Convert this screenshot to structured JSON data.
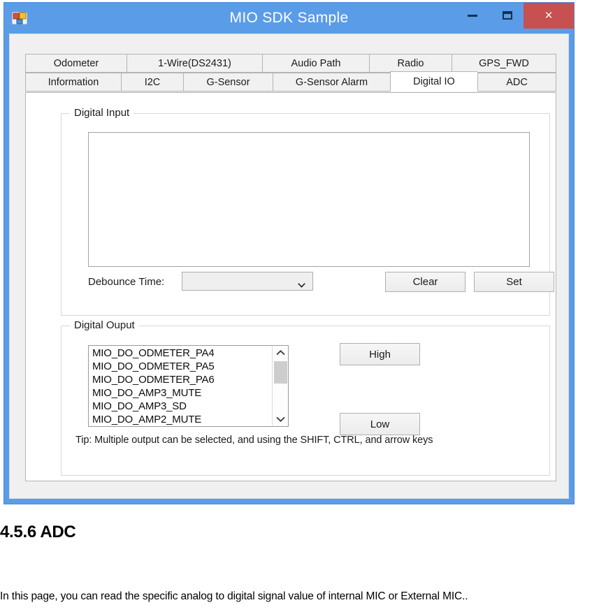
{
  "window": {
    "title": "MIO SDK Sample",
    "icon": "application-form-icon",
    "controls": {
      "minimize": "minimize-icon",
      "maximize": "maximize-icon",
      "close": "×"
    },
    "accent_color": "#5b9ce8",
    "close_color": "#c75050"
  },
  "tabs": {
    "row_top": [
      {
        "label": "Odometer",
        "width": 145,
        "selected": false
      },
      {
        "label": "1-Wire(DS2431)",
        "width": 194,
        "selected": false
      },
      {
        "label": "Audio Path",
        "width": 153,
        "selected": false
      },
      {
        "label": "Radio",
        "width": 118,
        "selected": false
      },
      {
        "label": "GPS_FWD",
        "width": 150,
        "selected": false
      }
    ],
    "row_bottom": [
      {
        "label": "Information",
        "width": 137,
        "selected": false
      },
      {
        "label": "I2C",
        "width": 89,
        "selected": false
      },
      {
        "label": "G-Sensor",
        "width": 128,
        "selected": false
      },
      {
        "label": "G-Sensor Alarm",
        "width": 168,
        "selected": false
      },
      {
        "label": "Digital IO",
        "width": 125,
        "selected": true
      },
      {
        "label": "ADC",
        "width": 113,
        "selected": false
      }
    ]
  },
  "digital_input": {
    "group_title": "Digital Input",
    "textbox_value": "",
    "debounce_label": "Debounce Time:",
    "debounce_value": "",
    "debounce_options": [],
    "clear_button": "Clear",
    "set_button": "Set"
  },
  "digital_output": {
    "group_title": "Digital Ouput",
    "items": [
      "MIO_DO_ODMETER_PA4",
      "MIO_DO_ODMETER_PA5",
      "MIO_DO_ODMETER_PA6",
      "MIO_DO_AMP3_MUTE",
      "MIO_DO_AMP3_SD",
      "MIO_DO_AMP2_MUTE"
    ],
    "high_button": "High",
    "low_button": "Low",
    "tip": "Tip: Multiple output can be selected, and using the SHIFT, CTRL, and arrow keys"
  },
  "document": {
    "heading": "4.5.6 ADC",
    "paragraph": "In this page, you can read the specific analog to digital signal value of internal MIC or External MIC.."
  }
}
